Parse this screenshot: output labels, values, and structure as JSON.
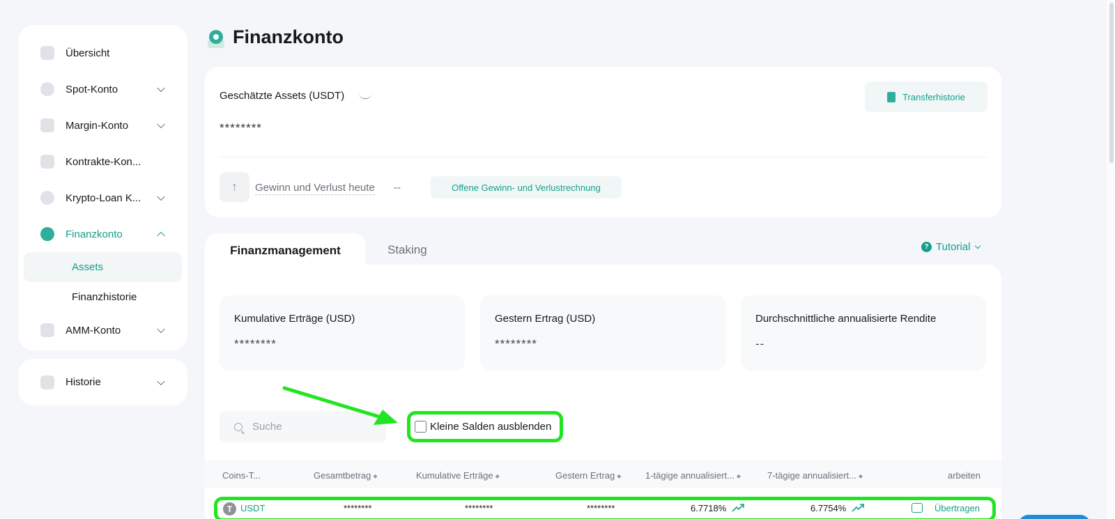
{
  "sidebar": {
    "items": [
      {
        "label": "Übersicht",
        "icon": "chart-icon"
      },
      {
        "label": "Spot-Konto",
        "icon": "coins-icon"
      },
      {
        "label": "Margin-Konto",
        "icon": "percent-icon"
      },
      {
        "label": "Kontrakte-Kon...",
        "icon": "contract-icon"
      },
      {
        "label": "Krypto-Loan K...",
        "icon": "loan-icon"
      },
      {
        "label": "Finanzkonto",
        "icon": "finance-icon"
      },
      {
        "label": "AMM-Konto",
        "icon": "amm-icon"
      }
    ],
    "sub_items": [
      "Assets",
      "Finanzhistorie"
    ],
    "history": {
      "label": "Historie",
      "icon": "history-icon"
    }
  },
  "page": {
    "title": "Finanzkonto"
  },
  "assets": {
    "label": "Geschätzte Assets (USDT)",
    "value": "********",
    "transfer_button": "Transferhistorie",
    "pnl_label": "Gewinn und Verlust heute",
    "pnl_value": "--",
    "pnl_button": "Offene Gewinn- und Verlustrechnung"
  },
  "tabs": {
    "active": "Finanzmanagement",
    "other": "Staking",
    "tutorial": "Tutorial"
  },
  "stats": [
    {
      "label": "Kumulative Erträge (USD)",
      "value": "********"
    },
    {
      "label": "Gestern Ertrag (USD)",
      "value": "********"
    },
    {
      "label": "Durchschnittliche annualisierte Rendite",
      "value": "--"
    }
  ],
  "search": {
    "placeholder": "Suche"
  },
  "filter": {
    "hide_small_label": "Kleine Salden ausblenden"
  },
  "table": {
    "headers": [
      "Coins-T...",
      "Gesamtbetrag",
      "Kumulative Erträge",
      "Gestern Ertrag",
      "1-tägige annualisiert...",
      "7-tägige annualisiert...",
      "arbeiten"
    ],
    "rows": [
      {
        "coin": "USDT",
        "total": "********",
        "cumulative": "********",
        "yesterday": "********",
        "apr1": "6.7718%",
        "apr7": "6.7754%",
        "action": "Übertragen"
      }
    ]
  },
  "colors": {
    "accent": "#12a08c",
    "highlight": "#22e522",
    "background": "#f4f6fa"
  }
}
